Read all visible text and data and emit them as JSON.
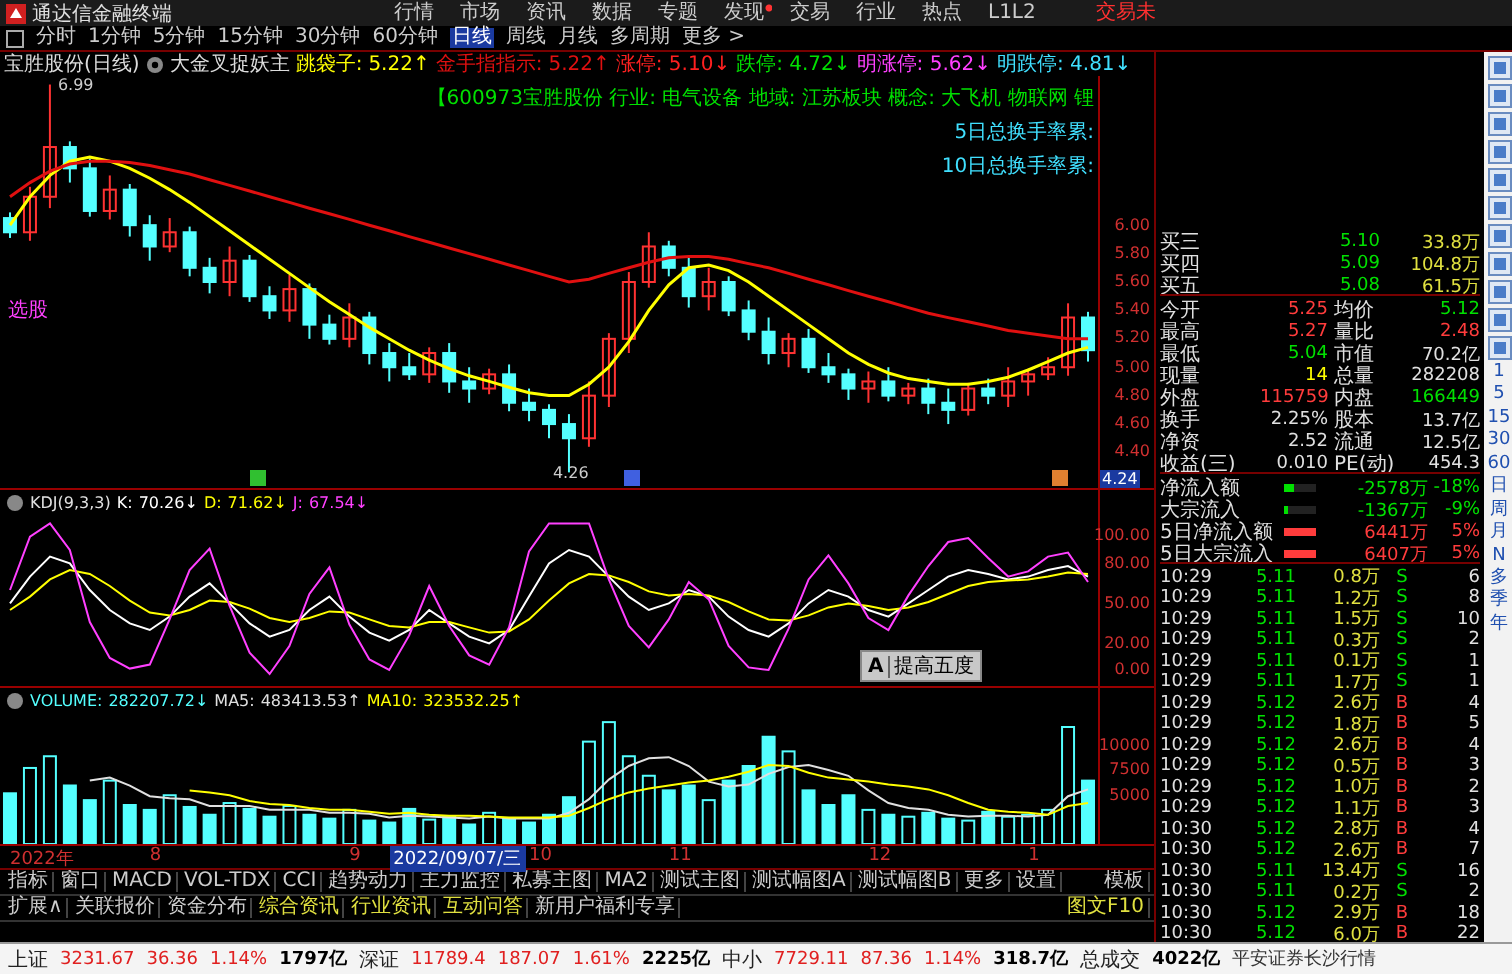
{
  "menu_bar": {
    "app_name": "通达信金融终端",
    "trade_label": "交易未",
    "items": [
      {
        "label": "行情",
        "badge": false
      },
      {
        "label": "市场",
        "badge": false
      },
      {
        "label": "资讯",
        "badge": false
      },
      {
        "label": "数据",
        "badge": false
      },
      {
        "label": "专题",
        "badge": false
      },
      {
        "label": "发现",
        "badge": true
      },
      {
        "label": "交易",
        "badge": false
      },
      {
        "label": "行业",
        "badge": false
      },
      {
        "label": "热点",
        "badge": false
      },
      {
        "label": "L1L2",
        "badge": false
      }
    ]
  },
  "period_bar": {
    "items": [
      {
        "label": "分时",
        "selected": false
      },
      {
        "label": "1分钟",
        "selected": false
      },
      {
        "label": "5分钟",
        "selected": false
      },
      {
        "label": "15分钟",
        "selected": false
      },
      {
        "label": "30分钟",
        "selected": false
      },
      {
        "label": "60分钟",
        "selected": false
      },
      {
        "label": "日线",
        "selected": true
      },
      {
        "label": "周线",
        "selected": false
      },
      {
        "label": "月线",
        "selected": false
      },
      {
        "label": "多周期",
        "selected": false
      },
      {
        "label": "更多 >",
        "selected": false
      }
    ]
  },
  "title_line": {
    "stock": "宝胜股份(日线)",
    "formula": "大金叉捉妖主",
    "series_readings": [
      "5.22↑",
      "5.22↑"
    ],
    "indicators": [
      {
        "label": "涨停:",
        "value": "5.10↓",
        "color": "#ff2020"
      },
      {
        "label": "跌停:",
        "value": "4.72↓",
        "color": "#00e000"
      },
      {
        "label": "明涨停:",
        "value": "5.62↓",
        "color": "#ff40ff"
      },
      {
        "label": "明跌停:",
        "value": "4.81↓",
        "color": "#40e0ff"
      }
    ]
  },
  "price_pane": {
    "signal_text": "选股",
    "axis_marker": "4.24",
    "signal_icons": [
      {
        "color": "#30c030"
      },
      {
        "color": "#4060e0"
      },
      {
        "color": "#e08030"
      }
    ],
    "overlay_lines": [
      {
        "text": "【600973宝胜股份 行业: 电气设备 地域: 江苏板块 概念: 大飞机 物联网 锂",
        "color": "#00e000"
      },
      {
        "text": "5日总换手率累:",
        "color": "#40e0ff"
      },
      {
        "text": "10日总换手率累:",
        "color": "#40e0ff"
      }
    ],
    "chart_data": {
      "type": "candlestick",
      "ylim": [
        4.15,
        7.05
      ],
      "yticks": [
        {
          "value": 6.0,
          "label": "6.00"
        },
        {
          "value": 5.8,
          "label": "5.80"
        },
        {
          "value": 5.6,
          "label": "5.60"
        },
        {
          "value": 5.4,
          "label": "5.40"
        },
        {
          "value": 5.2,
          "label": "5.20"
        },
        {
          "value": 5.0,
          "label": "5.00"
        },
        {
          "value": 4.8,
          "label": "4.80"
        },
        {
          "value": 4.6,
          "label": "4.60"
        },
        {
          "value": 4.4,
          "label": "4.40"
        }
      ],
      "ohlc": [
        [
          6.05,
          6.09,
          5.91,
          5.95
        ],
        [
          5.95,
          6.27,
          5.89,
          6.2
        ],
        [
          6.2,
          6.99,
          6.12,
          6.55
        ],
        [
          6.55,
          6.59,
          6.3,
          6.4
        ],
        [
          6.4,
          6.47,
          6.06,
          6.1
        ],
        [
          6.1,
          6.35,
          6.04,
          6.25
        ],
        [
          6.25,
          6.29,
          5.92,
          6.0
        ],
        [
          6.0,
          6.07,
          5.75,
          5.85
        ],
        [
          5.85,
          6.05,
          5.81,
          5.95
        ],
        [
          5.95,
          5.99,
          5.64,
          5.7
        ],
        [
          5.7,
          5.77,
          5.52,
          5.6
        ],
        [
          5.6,
          5.85,
          5.5,
          5.75
        ],
        [
          5.75,
          5.79,
          5.46,
          5.5
        ],
        [
          5.5,
          5.57,
          5.34,
          5.4
        ],
        [
          5.4,
          5.65,
          5.32,
          5.55
        ],
        [
          5.55,
          5.59,
          5.2,
          5.3
        ],
        [
          5.3,
          5.37,
          5.16,
          5.2
        ],
        [
          5.2,
          5.45,
          5.14,
          5.35
        ],
        [
          5.35,
          5.39,
          5.02,
          5.1
        ],
        [
          5.1,
          5.17,
          4.9,
          5.0
        ],
        [
          5.0,
          5.1,
          4.91,
          4.95
        ],
        [
          4.95,
          5.14,
          4.89,
          5.1
        ],
        [
          5.1,
          5.17,
          4.82,
          4.9
        ],
        [
          4.9,
          5.0,
          4.75,
          4.85
        ],
        [
          4.85,
          4.99,
          4.81,
          4.95
        ],
        [
          4.95,
          5.02,
          4.69,
          4.75
        ],
        [
          4.75,
          4.85,
          4.62,
          4.7
        ],
        [
          4.7,
          4.74,
          4.5,
          4.6
        ],
        [
          4.6,
          4.67,
          4.26,
          4.5
        ],
        [
          4.5,
          4.9,
          4.44,
          4.8
        ],
        [
          4.8,
          5.24,
          4.72,
          5.2
        ],
        [
          5.2,
          5.67,
          5.1,
          5.6
        ],
        [
          5.6,
          5.95,
          5.56,
          5.85
        ],
        [
          5.85,
          5.89,
          5.64,
          5.7
        ],
        [
          5.7,
          5.77,
          5.42,
          5.5
        ],
        [
          5.5,
          5.7,
          5.4,
          5.6
        ],
        [
          5.6,
          5.64,
          5.36,
          5.4
        ],
        [
          5.4,
          5.47,
          5.19,
          5.25
        ],
        [
          5.25,
          5.35,
          5.02,
          5.1
        ],
        [
          5.1,
          5.24,
          5.0,
          5.2
        ],
        [
          5.2,
          5.27,
          4.96,
          5.0
        ],
        [
          5.0,
          5.1,
          4.89,
          4.95
        ],
        [
          4.95,
          4.99,
          4.77,
          4.85
        ],
        [
          4.85,
          4.97,
          4.75,
          4.9
        ],
        [
          4.9,
          5.0,
          4.76,
          4.8
        ],
        [
          4.8,
          4.89,
          4.74,
          4.85
        ],
        [
          4.85,
          4.92,
          4.67,
          4.75
        ],
        [
          4.75,
          4.85,
          4.6,
          4.7
        ],
        [
          4.7,
          4.89,
          4.66,
          4.85
        ],
        [
          4.85,
          4.92,
          4.74,
          4.8
        ],
        [
          4.8,
          5.0,
          4.72,
          4.9
        ],
        [
          4.9,
          4.99,
          4.8,
          4.95
        ],
        [
          4.95,
          5.07,
          4.91,
          5.0
        ],
        [
          5.0,
          5.45,
          4.94,
          5.35
        ],
        [
          5.35,
          5.39,
          5.04,
          5.12
        ]
      ],
      "series": [
        {
          "name": "跳袋子:",
          "color": "#ffff00",
          "type": "line",
          "values": [
            6.0,
            6.2,
            6.35,
            6.45,
            6.48,
            6.45,
            6.4,
            6.33,
            6.25,
            6.16,
            6.06,
            5.96,
            5.86,
            5.76,
            5.66,
            5.56,
            5.46,
            5.37,
            5.28,
            5.2,
            5.12,
            5.05,
            4.99,
            4.94,
            4.9,
            4.86,
            4.82,
            4.8,
            4.8,
            4.88,
            5.0,
            5.18,
            5.4,
            5.58,
            5.7,
            5.72,
            5.68,
            5.6,
            5.5,
            5.4,
            5.3,
            5.2,
            5.1,
            5.02,
            4.96,
            4.92,
            4.9,
            4.88,
            4.88,
            4.9,
            4.93,
            4.98,
            5.04,
            5.1,
            5.14
          ]
        },
        {
          "name": "金手指指示:",
          "color": "#e01010",
          "type": "line",
          "values": [
            6.2,
            6.3,
            6.38,
            6.43,
            6.45,
            6.45,
            6.44,
            6.42,
            6.39,
            6.36,
            6.32,
            6.28,
            6.24,
            6.2,
            6.16,
            6.12,
            6.08,
            6.04,
            6.0,
            5.96,
            5.92,
            5.88,
            5.84,
            5.8,
            5.76,
            5.72,
            5.68,
            5.64,
            5.6,
            5.62,
            5.66,
            5.7,
            5.74,
            5.77,
            5.78,
            5.78,
            5.76,
            5.73,
            5.7,
            5.66,
            5.62,
            5.58,
            5.54,
            5.5,
            5.46,
            5.42,
            5.38,
            5.35,
            5.32,
            5.29,
            5.26,
            5.24,
            5.22,
            5.2,
            5.2
          ]
        }
      ],
      "annotations": [
        "6.99",
        "4.26"
      ]
    }
  },
  "kdj_pane": {
    "label": "KDJ(9,3,3)",
    "readings": [
      "70.26↓",
      "71.62↓",
      "67.54↓"
    ],
    "popup": {
      "icon_text": "A",
      "label": "提高五度"
    },
    "chart_data": {
      "type": "line",
      "ylim": [
        -12,
        135
      ],
      "yticks": [
        {
          "value": 100,
          "label": "100.00"
        },
        {
          "value": 80,
          "label": "80.00"
        },
        {
          "value": 50,
          "label": "50.00"
        },
        {
          "value": 20,
          "label": "20.00"
        },
        {
          "value": 0,
          "label": "0.00"
        }
      ],
      "series": [
        {
          "name": "K:",
          "color": "#ffffff",
          "values": [
            50,
            70,
            85,
            80,
            60,
            45,
            35,
            30,
            40,
            55,
            65,
            50,
            35,
            25,
            30,
            45,
            55,
            40,
            28,
            22,
            30,
            45,
            35,
            25,
            20,
            30,
            55,
            80,
            90,
            85,
            70,
            55,
            45,
            50,
            60,
            55,
            40,
            30,
            25,
            35,
            50,
            60,
            55,
            45,
            40,
            50,
            60,
            70,
            75,
            72,
            68,
            70,
            75,
            78,
            70
          ]
        },
        {
          "name": "D:",
          "color": "#ffff00",
          "values": [
            45,
            55,
            68,
            75,
            72,
            63,
            52,
            43,
            41,
            45,
            52,
            51,
            46,
            39,
            36,
            39,
            44,
            43,
            38,
            33,
            32,
            36,
            36,
            32,
            28,
            29,
            38,
            52,
            65,
            72,
            71,
            66,
            59,
            56,
            57,
            56,
            51,
            44,
            38,
            37,
            41,
            47,
            50,
            48,
            45,
            47,
            51,
            57,
            63,
            66,
            67,
            68,
            70,
            73,
            72
          ]
        },
        {
          "name": "J:",
          "color": "#ff40ff",
          "values": [
            60,
            100,
            110,
            90,
            36,
            9,
            1,
            4,
            38,
            75,
            91,
            48,
            13,
            -3,
            18,
            57,
            77,
            34,
            8,
            0,
            26,
            63,
            33,
            11,
            4,
            32,
            89,
            110,
            110,
            110,
            68,
            33,
            17,
            38,
            66,
            53,
            18,
            2,
            0,
            31,
            68,
            86,
            65,
            39,
            30,
            56,
            78,
            96,
            99,
            84,
            70,
            74,
            85,
            88,
            66
          ]
        }
      ]
    }
  },
  "volume_pane": {
    "readings": [
      "282207.72↓",
      "483413.53↑",
      "323532.25↑"
    ],
    "date_labels": [
      "2022年",
      "8",
      "9",
      "10",
      "11",
      "12",
      "1"
    ],
    "cursor_date": "2022/09/07/三",
    "chart_data": {
      "type": "bar",
      "ylim": [
        0,
        16000
      ],
      "yticks": [
        {
          "value": 10000,
          "label": "10000"
        },
        {
          "value": 7500,
          "label": "7500"
        },
        {
          "value": 5000,
          "label": "5000"
        }
      ],
      "series": [
        {
          "name": "VOLUME:",
          "color": "#54ffff",
          "type": "bar",
          "values": [
            5200,
            7800,
            9000,
            6000,
            4500,
            6500,
            4000,
            3500,
            5000,
            3800,
            3000,
            4200,
            3600,
            2800,
            3900,
            3000,
            2600,
            3500,
            2400,
            2200,
            3600,
            2500,
            2800,
            2000,
            3200,
            2600,
            2200,
            3000,
            4800,
            10500,
            12500,
            9000,
            7000,
            5500,
            6000,
            4500,
            6500,
            8000,
            11000,
            9500,
            5500,
            4000,
            5000,
            3500,
            3000,
            2800,
            3200,
            2600,
            2400,
            3300,
            2800,
            3000,
            3500,
            12000,
            6500
          ]
        },
        {
          "name": "MA5:",
          "color": "#e0e0e0",
          "type": "line",
          "values": [
            null,
            null,
            null,
            null,
            6500,
            6800,
            6000,
            4900,
            4700,
            4600,
            3900,
            3900,
            3900,
            3500,
            3500,
            3500,
            3200,
            3200,
            3100,
            2700,
            2900,
            2800,
            2700,
            2600,
            2800,
            2600,
            2600,
            2600,
            3200,
            4600,
            6600,
            8000,
            8800,
            8900,
            8000,
            6400,
            5900,
            6100,
            7200,
            7900,
            8100,
            7600,
            7000,
            5500,
            4200,
            3700,
            3500,
            3000,
            2800,
            2900,
            2900,
            2800,
            3000,
            4900,
            5600
          ]
        },
        {
          "name": "MA10:",
          "color": "#ffff00",
          "type": "line",
          "values": [
            null,
            null,
            null,
            null,
            null,
            null,
            null,
            null,
            null,
            5500,
            5300,
            5000,
            4400,
            4100,
            4000,
            3700,
            3500,
            3500,
            3300,
            3100,
            3200,
            3000,
            2900,
            2900,
            2800,
            2700,
            2700,
            2700,
            2900,
            3700,
            4600,
            5300,
            5700,
            6000,
            6300,
            6500,
            6900,
            7400,
            8100,
            8000,
            7300,
            6800,
            6600,
            6400,
            6100,
            5900,
            5600,
            5000,
            4200,
            3500,
            3300,
            3200,
            3000,
            3900,
            4200
          ]
        }
      ]
    }
  },
  "indicator_tabs": {
    "items": [
      "指标",
      "窗口",
      "MACD",
      "VOL-TDX",
      "CCI",
      "趋势动力",
      "主力监控",
      "私募主图",
      "MA2",
      "测试主图",
      "测试幅图A",
      "测试幅图B",
      "更多",
      "设置"
    ],
    "right": "模板"
  },
  "extension_bar": {
    "items": [
      {
        "label": "扩展∧",
        "highlighted": false
      },
      {
        "label": "关联报价",
        "highlighted": false
      },
      {
        "label": "资金分布",
        "highlighted": false
      },
      {
        "label": "综合资讯",
        "highlighted": true
      },
      {
        "label": "行业资讯",
        "highlighted": true
      },
      {
        "label": "互动问答",
        "highlighted": true
      },
      {
        "label": "新用户福利专享",
        "highlighted": false
      }
    ],
    "right": "图文F10"
  },
  "quote_panel": {
    "book": [
      {
        "label": "买三",
        "price": "5.10",
        "volume": "33.8万"
      },
      {
        "label": "买四",
        "price": "5.09",
        "volume": "104.8万"
      },
      {
        "label": "买五",
        "price": "5.08",
        "volume": "61.5万"
      }
    ],
    "stats": [
      [
        {
          "label": "今开",
          "value": "5.25",
          "color": "#ff3c3c"
        },
        {
          "label": "均价",
          "value": "5.12",
          "color": "#00e000"
        }
      ],
      [
        {
          "label": "最高",
          "value": "5.27",
          "color": "#ff3c3c"
        },
        {
          "label": "量比",
          "value": "2.48",
          "color": "#ff3c3c"
        }
      ],
      [
        {
          "label": "最低",
          "value": "5.04",
          "color": "#00e000"
        },
        {
          "label": "市值",
          "value": "70.2亿",
          "color": "#e0e0e0"
        }
      ],
      [
        {
          "label": "现量",
          "value": "14",
          "color": "#ffff00"
        },
        {
          "label": "总量",
          "value": "282208",
          "color": "#e0e0e0"
        }
      ],
      [
        {
          "label": "外盘",
          "value": "115759",
          "color": "#ff3c3c"
        },
        {
          "label": "内盘",
          "value": "166449",
          "color": "#00e000"
        }
      ],
      [
        {
          "label": "换手",
          "value": "2.25%",
          "color": "#e0e0e0"
        },
        {
          "label": "股本",
          "value": "13.7亿",
          "color": "#e0e0e0"
        }
      ],
      [
        {
          "label": "净资",
          "value": "2.52",
          "color": "#e0e0e0"
        },
        {
          "label": "流通",
          "value": "12.5亿",
          "color": "#e0e0e0"
        }
      ],
      [
        {
          "label": "收益(三)",
          "value": "0.010",
          "color": "#e0e0e0"
        },
        {
          "label": "PE(动)",
          "value": "454.3",
          "color": "#e0e0e0"
        }
      ]
    ],
    "flows": [
      {
        "label": "净流入额",
        "value": "-2578万",
        "percent": "-18%",
        "color": "#00e000",
        "level": 0.3
      },
      {
        "label": "大宗流入",
        "value": "-1367万",
        "percent": "-9%",
        "color": "#00e000",
        "level": 0.15
      },
      {
        "label": "5日净流入额",
        "value": "6441万",
        "percent": "5%",
        "color": "#ff3c3c",
        "level": 1
      },
      {
        "label": "5日大宗流入",
        "value": "6407万",
        "percent": "5%",
        "color": "#ff3c3c",
        "level": 1
      }
    ],
    "ticks": [
      {
        "time": "10:29",
        "price": "5.11",
        "volume": "0.8万",
        "side": "S",
        "count": "6"
      },
      {
        "time": "10:29",
        "price": "5.11",
        "volume": "1.2万",
        "side": "S",
        "count": "8"
      },
      {
        "time": "10:29",
        "price": "5.11",
        "volume": "1.5万",
        "side": "S",
        "count": "10"
      },
      {
        "time": "10:29",
        "price": "5.11",
        "volume": "0.3万",
        "side": "S",
        "count": "2"
      },
      {
        "time": "10:29",
        "price": "5.11",
        "volume": "0.1万",
        "side": "S",
        "count": "1"
      },
      {
        "time": "10:29",
        "price": "5.11",
        "volume": "1.7万",
        "side": "S",
        "count": "1"
      },
      {
        "time": "10:29",
        "price": "5.12",
        "volume": "2.6万",
        "side": "B",
        "count": "4"
      },
      {
        "time": "10:29",
        "price": "5.12",
        "volume": "1.8万",
        "side": "B",
        "count": "5"
      },
      {
        "time": "10:29",
        "price": "5.12",
        "volume": "2.6万",
        "side": "B",
        "count": "4"
      },
      {
        "time": "10:29",
        "price": "5.12",
        "volume": "0.5万",
        "side": "B",
        "count": "3"
      },
      {
        "time": "10:29",
        "price": "5.12",
        "volume": "1.0万",
        "side": "B",
        "count": "2"
      },
      {
        "time": "10:29",
        "price": "5.12",
        "volume": "1.1万",
        "side": "B",
        "count": "3"
      },
      {
        "time": "10:30",
        "price": "5.12",
        "volume": "2.8万",
        "side": "B",
        "count": "4"
      },
      {
        "time": "10:30",
        "price": "5.12",
        "volume": "2.6万",
        "side": "B",
        "count": "7"
      },
      {
        "time": "10:30",
        "price": "5.11",
        "volume": "13.4万",
        "side": "S",
        "count": "16"
      },
      {
        "time": "10:30",
        "price": "5.11",
        "volume": "0.2万",
        "side": "S",
        "count": "2"
      },
      {
        "time": "10:30",
        "price": "5.12",
        "volume": "2.9万",
        "side": "B",
        "count": "18"
      },
      {
        "time": "10:30",
        "price": "5.12",
        "volume": "6.0万",
        "side": "B",
        "count": "22"
      }
    ]
  },
  "side_periods": [
    "1",
    "5",
    "15",
    "30",
    "60",
    "日",
    "周",
    "月",
    "N",
    "多",
    "季",
    "年"
  ],
  "status_bar": {
    "indices": [
      {
        "name": "上证",
        "value": "3231.67",
        "change": "36.36",
        "percent": "1.14%",
        "amount": "1797亿",
        "color": "#e02020"
      },
      {
        "name": "深证",
        "value": "11789.4",
        "change": "187.07",
        "percent": "1.61%",
        "amount": "2225亿",
        "color": "#e02020"
      },
      {
        "name": "中小",
        "value": "7729.11",
        "change": "87.36",
        "percent": "1.14%",
        "amount": "318.7亿",
        "color": "#e02020"
      }
    ],
    "total_label": "总成交",
    "total_value": "4022亿",
    "source": "平安证券长沙行情"
  }
}
